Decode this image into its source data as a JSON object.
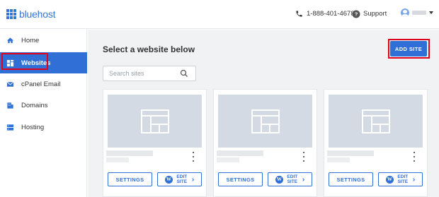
{
  "brand": {
    "name": "bluehost",
    "color": "#3575d3"
  },
  "header": {
    "phone": "1-888-401-4678",
    "support_label": "Support"
  },
  "sidebar": {
    "items": [
      {
        "label": "Home",
        "icon": "home-icon"
      },
      {
        "label": "Websites",
        "icon": "websites-icon",
        "active": true
      },
      {
        "label": "cPanel Email",
        "icon": "envelope-icon"
      },
      {
        "label": "Domains",
        "icon": "building-icon"
      },
      {
        "label": "Hosting",
        "icon": "server-icon"
      }
    ]
  },
  "main": {
    "title": "Select a website below",
    "add_site_label": "ADD SITE",
    "search_placeholder": "Search sites",
    "cards": [
      {
        "settings_label": "SETTINGS",
        "edit_label_top": "EDIT",
        "edit_label_bottom": "SITE"
      },
      {
        "settings_label": "SETTINGS",
        "edit_label_top": "EDIT",
        "edit_label_bottom": "SITE"
      },
      {
        "settings_label": "SETTINGS",
        "edit_label_top": "EDIT",
        "edit_label_bottom": "SITE"
      }
    ]
  },
  "colors": {
    "accent": "#2f6fd6",
    "highlight": "#e0001b",
    "background": "#f1f2f4"
  }
}
